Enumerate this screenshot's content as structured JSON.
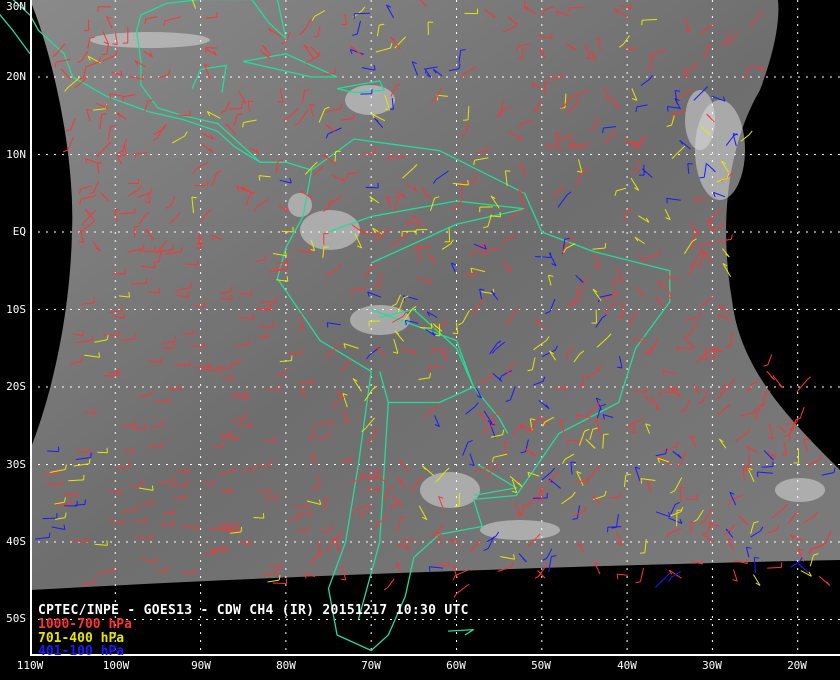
{
  "title": "CPTEC/INPE - GOES13 - CDW CH4 (IR) 20151217 10:30 UTC",
  "legend": [
    {
      "label": "1000-700 hPa",
      "color": "#ff3333"
    },
    {
      "label": "701-400 hPa",
      "color": "#e6e600"
    },
    {
      "label": "401-100 hPa",
      "color": "#1a1aff"
    }
  ],
  "latitude_labels": [
    "30N",
    "20N",
    "10N",
    "EQ",
    "10S",
    "20S",
    "30S",
    "40S",
    "50S"
  ],
  "longitude_labels": [
    "110W",
    "100W",
    "90W",
    "80W",
    "70W",
    "60W",
    "50W",
    "40W",
    "30W",
    "20W"
  ],
  "colors": {
    "coastline": "#22dd99",
    "grid": "#ffffff",
    "background": "#000000",
    "cloud": "#7a7a7a"
  }
}
